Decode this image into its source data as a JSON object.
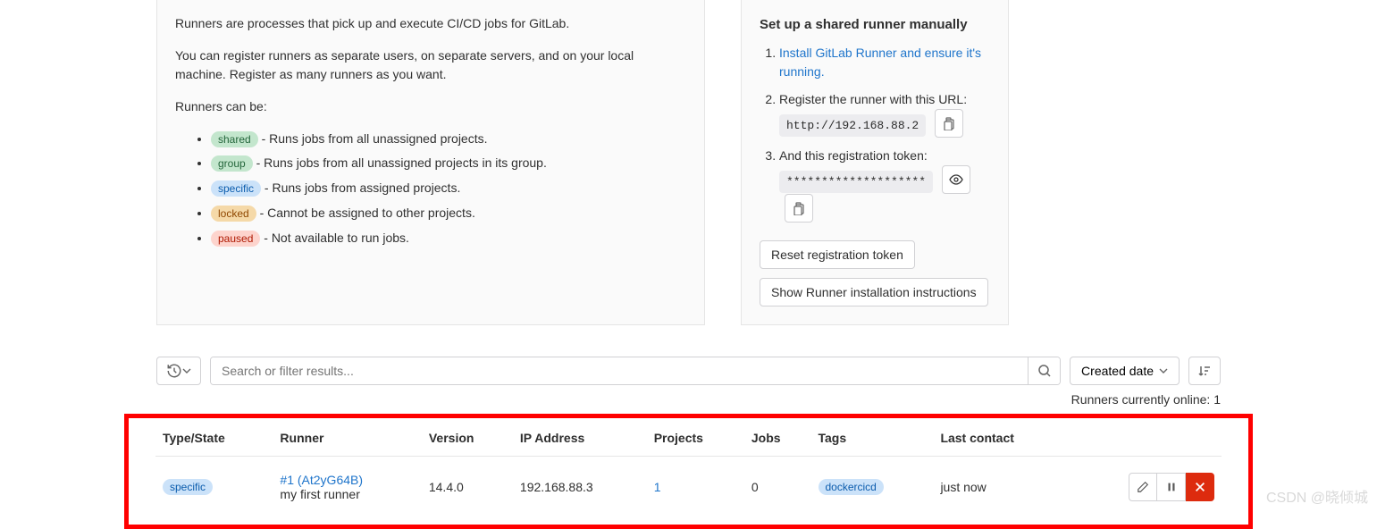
{
  "info": {
    "p1": "Runners are processes that pick up and execute CI/CD jobs for GitLab.",
    "p2": "You can register runners as separate users, on separate servers, and on your local machine. Register as many runners as you want.",
    "p3": "Runners can be:",
    "types": {
      "shared": {
        "label": "shared",
        "desc": " - Runs jobs from all unassigned projects."
      },
      "group": {
        "label": "group",
        "desc": " - Runs jobs from all unassigned projects in its group."
      },
      "specific": {
        "label": "specific",
        "desc": " - Runs jobs from assigned projects."
      },
      "locked": {
        "label": "locked",
        "desc": " - Cannot be assigned to other projects."
      },
      "paused": {
        "label": "paused",
        "desc": " - Not available to run jobs."
      }
    }
  },
  "setup": {
    "title": "Set up a shared runner manually",
    "step1_link": "Install GitLab Runner and ensure it's running.",
    "step2": "Register the runner with this URL:",
    "url": "http://192.168.88.2",
    "step3": "And this registration token:",
    "token_masked": "********************",
    "reset_btn": "Reset registration token",
    "instructions_btn": "Show Runner installation instructions"
  },
  "filter": {
    "placeholder": "Search or filter results...",
    "sort_label": "Created date"
  },
  "online": {
    "label": "Runners currently online: ",
    "count": "1"
  },
  "table": {
    "headers": {
      "type": "Type/State",
      "runner": "Runner",
      "version": "Version",
      "ip": "IP Address",
      "projects": "Projects",
      "jobs": "Jobs",
      "tags": "Tags",
      "last": "Last contact"
    },
    "row": {
      "type_badge": "specific",
      "name": "#1 (At2yG64B)",
      "desc": "my first runner",
      "version": "14.4.0",
      "ip": "192.168.88.3",
      "projects": "1",
      "jobs": "0",
      "tag": "dockercicd",
      "last": "just now"
    }
  },
  "watermark": "CSDN @晓倾城"
}
